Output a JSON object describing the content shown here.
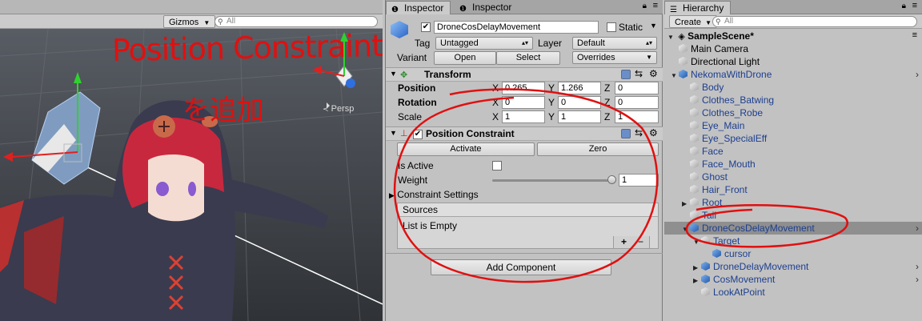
{
  "scene": {
    "gizmos_label": "Gizmos",
    "search_placeholder": "All",
    "persp_label": "Persp"
  },
  "annotation": {
    "title": "Position Constraint",
    "subtitle": "を追加"
  },
  "inspector": {
    "tabs": [
      {
        "label": "Inspector",
        "active": true
      },
      {
        "label": "Inspector",
        "active": false
      }
    ],
    "object_name": "DroneCosDelayMovement",
    "static_label": "Static",
    "tag_label": "Tag",
    "tag_value": "Untagged",
    "layer_label": "Layer",
    "layer_value": "Default",
    "variant_label": "Variant",
    "open_label": "Open",
    "select_label": "Select",
    "overrides_label": "Overrides",
    "transform": {
      "title": "Transform",
      "rows": [
        {
          "label": "Position",
          "x": "0.265",
          "y": "1.266",
          "z": "0",
          "bold": true
        },
        {
          "label": "Rotation",
          "x": "0",
          "y": "0",
          "z": "0",
          "bold": true
        },
        {
          "label": "Scale",
          "x": "1",
          "y": "1",
          "z": "1",
          "bold": false
        }
      ],
      "axis_x": "X",
      "axis_y": "Y",
      "axis_z": "Z"
    },
    "constraint": {
      "title": "Position Constraint",
      "activate_label": "Activate",
      "zero_label": "Zero",
      "is_active_label": "Is Active",
      "weight_label": "Weight",
      "weight_value": "1",
      "weight_fraction": 1.0,
      "settings_label": "Constraint Settings",
      "sources_label": "Sources",
      "empty_label": "List is Empty",
      "plus": "+",
      "minus": "−"
    },
    "add_component_label": "Add Component"
  },
  "hierarchy": {
    "tab_label": "Hierarchy",
    "create_label": "Create",
    "search_placeholder": "All",
    "scene_name": "SampleScene*",
    "items": [
      {
        "label": "Main Camera",
        "indent": 1,
        "icon": "gray",
        "blue": false
      },
      {
        "label": "Directional Light",
        "indent": 1,
        "icon": "gray",
        "blue": false
      },
      {
        "label": "NekomaWithDrone",
        "indent": 1,
        "icon": "blue",
        "blue": true,
        "expanded": true,
        "chevron": true
      },
      {
        "label": "Body",
        "indent": 2,
        "icon": "gray",
        "blue": true
      },
      {
        "label": "Clothes_Batwing",
        "indent": 2,
        "icon": "gray",
        "blue": true
      },
      {
        "label": "Clothes_Robe",
        "indent": 2,
        "icon": "gray",
        "blue": true
      },
      {
        "label": "Eye_Main",
        "indent": 2,
        "icon": "gray",
        "blue": true
      },
      {
        "label": "Eye_SpecialEff",
        "indent": 2,
        "icon": "gray",
        "blue": true
      },
      {
        "label": "Face",
        "indent": 2,
        "icon": "gray",
        "blue": true
      },
      {
        "label": "Face_Mouth",
        "indent": 2,
        "icon": "gray",
        "blue": true
      },
      {
        "label": "Ghost",
        "indent": 2,
        "icon": "gray",
        "blue": true
      },
      {
        "label": "Hair_Front",
        "indent": 2,
        "icon": "gray",
        "blue": true
      },
      {
        "label": "Root",
        "indent": 2,
        "icon": "gray",
        "blue": true,
        "collapsed": true
      },
      {
        "label": "Tail",
        "indent": 2,
        "icon": "gray",
        "blue": true
      },
      {
        "label": "DroneCosDelayMovement",
        "indent": 2,
        "icon": "blue",
        "blue": true,
        "selected": true,
        "expanded": true,
        "chevron": true
      },
      {
        "label": "Target",
        "indent": 3,
        "icon": "gray",
        "blue": true,
        "expanded": true
      },
      {
        "label": "cursor",
        "indent": 4,
        "icon": "blue",
        "blue": true
      },
      {
        "label": "DroneDelayMovement",
        "indent": 3,
        "icon": "blue",
        "blue": true,
        "collapsed": true,
        "chevron": true
      },
      {
        "label": "CosMovement",
        "indent": 3,
        "icon": "blue",
        "blue": true,
        "collapsed": true,
        "chevron": true
      },
      {
        "label": "LookAtPoint",
        "indent": 3,
        "icon": "gray",
        "blue": true
      }
    ]
  },
  "colors": {
    "annotation_red": "#e01010",
    "selection_gray": "#8f8f8f",
    "prefab_blue": "#1d3f8f"
  }
}
